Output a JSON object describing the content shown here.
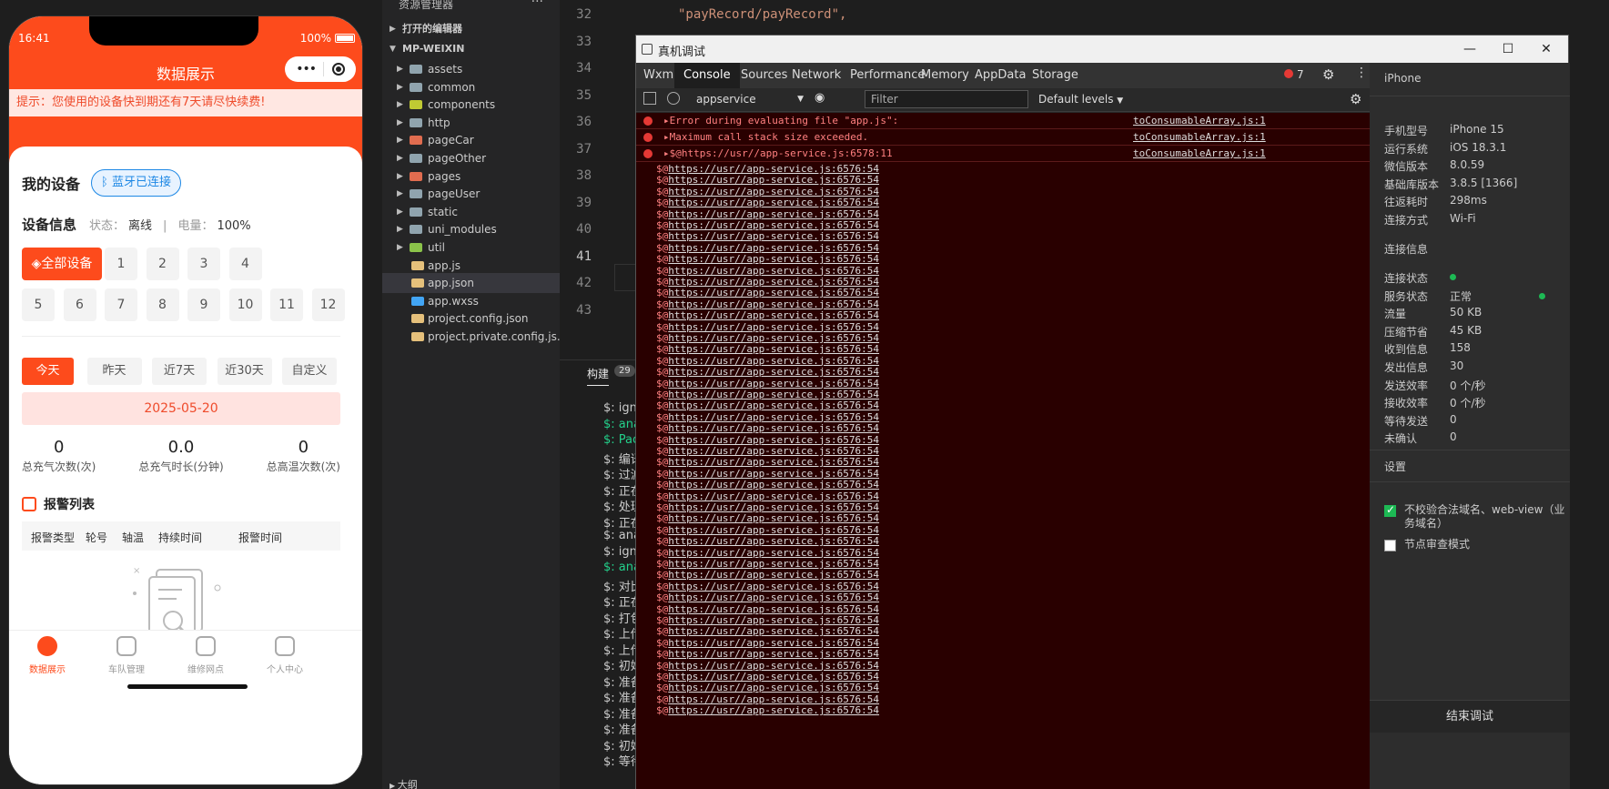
{
  "phone": {
    "time": "16:41",
    "battery": "100%",
    "title": "数据展示",
    "notice": "提示：您使用的设备快到期还有7天请尽快续费!",
    "my_device": "我的设备",
    "bluetooth": "蓝牙已连接",
    "device_info": "设备信息",
    "status_label": "状态：",
    "status_value": "离线",
    "power_label": "电量：",
    "power_value": "100%",
    "all_devices": "全部设备",
    "device_buttons": [
      "1",
      "2",
      "3",
      "4",
      "5",
      "6",
      "7",
      "8",
      "9",
      "10",
      "11",
      "12"
    ],
    "date_tabs": [
      "今天",
      "昨天",
      "近7天",
      "近30天",
      "自定义"
    ],
    "date": "2025-05-20",
    "stats": [
      {
        "value": "0",
        "label": "总充气次数(次)"
      },
      {
        "value": "0.0",
        "label": "总充气时长(分钟)"
      },
      {
        "value": "0",
        "label": "总高温次数(次)"
      }
    ],
    "alarm_title": "报警列表",
    "alarm_headers": [
      "报警类型",
      "轮号",
      "轴温",
      "持续时间",
      "报警时间"
    ],
    "tabs": [
      "数据展示",
      "车队管理",
      "维修网点",
      "个人中心"
    ]
  },
  "explorer": {
    "header": "资源管理器",
    "more": "···",
    "open_editors": "打开的编辑器",
    "project": "MP-WEIXIN",
    "folders": [
      "assets",
      "common",
      "components",
      "http",
      "pageCar",
      "pageOther",
      "pages",
      "pageUser",
      "static",
      "uni_modules",
      "util"
    ],
    "files": [
      "app.js",
      "app.json",
      "app.wxss",
      "project.config.json",
      "project.private.config.js..."
    ],
    "outline": "大纲"
  },
  "editor": {
    "lines": [
      "32",
      "33",
      "34",
      "35",
      "36",
      "37",
      "38",
      "39",
      "40",
      "41",
      "42",
      "43"
    ],
    "code_line": "\"payRecord/payRecord\","
  },
  "terminal": {
    "tab": "构建",
    "badge": "29",
    "lines": [
      "$: ign",
      "$: ana",
      "$: Pac",
      "$: 编译",
      "$: 过滤",
      "$: 正在",
      "$: 处理",
      "$: 正在",
      "$: ana",
      "$: ign",
      "$: ana",
      "$: 对比",
      "$: 正在",
      "$: 打包",
      "$: 上传",
      "$: 上传",
      "$: 初始",
      "$: 准备",
      "$: 准备",
      "$: 准备",
      "$: 准备",
      "$: 初始",
      "$: 等待"
    ]
  },
  "devtools": {
    "title": "真机调试",
    "tabs": [
      "Wxml",
      "Console",
      "Sources",
      "Network",
      "Performance",
      "Memory",
      "AppData",
      "Storage"
    ],
    "error_count": "7",
    "context": "appservice",
    "filter_placeholder": "Filter",
    "levels": "Default levels",
    "errors": [
      {
        "msg": "▸Error during evaluating file \"app.js\":",
        "src": "toConsumableArray.js:1"
      },
      {
        "msg": "▸Maximum call stack size exceeded.",
        "src": "toConsumableArray.js:1"
      },
      {
        "msg": "▸$@https://usr//app-service.js:6578:11",
        "src": "toConsumableArray.js:1"
      }
    ],
    "stack_prefix": "$@",
    "stack_link": "https://usr//app-service.js:6576:54",
    "stack_count": 49
  },
  "panel": {
    "device": "iPhone",
    "info": [
      {
        "k": "手机型号",
        "v": "iPhone 15"
      },
      {
        "k": "运行系统",
        "v": "iOS 18.3.1"
      },
      {
        "k": "微信版本",
        "v": "8.0.59"
      },
      {
        "k": "基础库版本",
        "v": "3.8.5 [1366]"
      },
      {
        "k": "往返耗时",
        "v": "298ms"
      },
      {
        "k": "连接方式",
        "v": "Wi-Fi"
      }
    ],
    "conn_title": "连接信息",
    "conn": [
      {
        "k": "连接状态",
        "v": ""
      },
      {
        "k": "服务状态",
        "v": "正常"
      },
      {
        "k": "流量",
        "v": "50 KB"
      },
      {
        "k": "压缩节省",
        "v": "45 KB"
      },
      {
        "k": "收到信息",
        "v": "158"
      },
      {
        "k": "发出信息",
        "v": "30"
      },
      {
        "k": "发送效率",
        "v": "0 个/秒"
      },
      {
        "k": "接收效率",
        "v": "0 个/秒"
      },
      {
        "k": "等待发送",
        "v": "0"
      },
      {
        "k": "未确认",
        "v": "0"
      }
    ],
    "settings": "设置",
    "check1": "不校验合法域名、web-view（业务域名）",
    "check2": "节点审查模式",
    "end": "结束调试"
  },
  "colors": {
    "accent": "#fd4b1c",
    "console_bg": "#290000",
    "error_text": "#ff8080"
  }
}
